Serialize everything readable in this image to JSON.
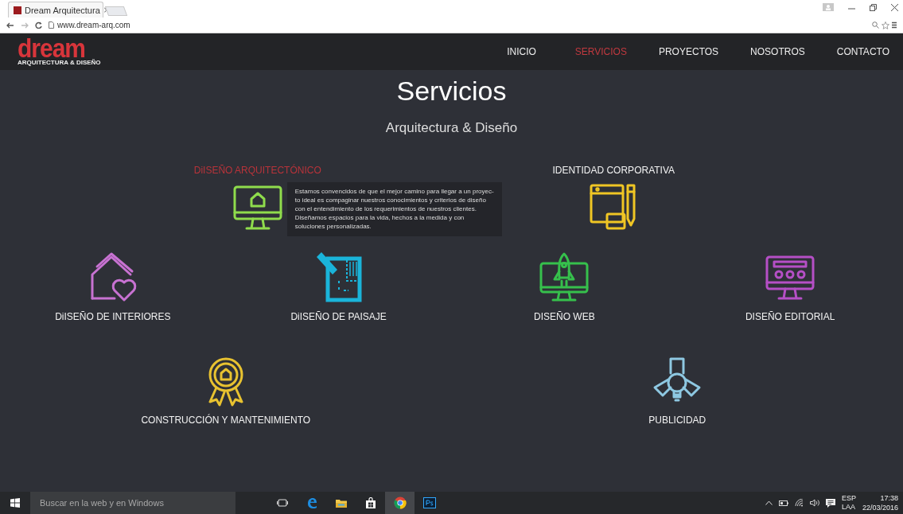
{
  "browser": {
    "tab": {
      "title": "Dream Arquitectura",
      "close": "×"
    },
    "url": "www.dream-arq.com"
  },
  "site": {
    "logo": {
      "word": "dream",
      "tagline": "ARQUITECTURA & DISEÑO"
    },
    "nav": [
      {
        "label": "INICIO",
        "selected": false
      },
      {
        "label": "SERVICIOS",
        "selected": true
      },
      {
        "label": "PROYECTOS",
        "selected": false
      },
      {
        "label": "NOSOTROS",
        "selected": false
      },
      {
        "label": "CONTACTO",
        "selected": false
      }
    ],
    "title": "Servicios",
    "subtitle": "Arquitectura & Diseño",
    "service_rows": [
      {
        "kind": "label_top",
        "services": [
          {
            "label": "DiISEÑO ARQUITECTÓNICO",
            "color": "#8fdc4c",
            "highlighted": true,
            "tooltip": "Estamos convencidos de que el mejor camino para llegar a un proyec-to ideal es compaginar nuestros conocimientos y criterios de diseño con el entendimiento de los requerimientos de nuestros clientes. Diseñamos espacios para la vida, hechos a la medida y con soluciones personalizadas."
          },
          {
            "label": "IDENTIDAD CORPORATIVA",
            "color": "#f0c624",
            "highlighted": false
          }
        ]
      },
      {
        "kind": "label_bottom",
        "services": [
          {
            "label": "DiISEÑO DE INTERIORES",
            "color": "#c872d2",
            "highlighted": false
          },
          {
            "label": "DiISEÑO DE PAISAJE",
            "color": "#1ab4da",
            "highlighted": false
          },
          {
            "label": "DISEÑO WEB",
            "color": "#36c04c",
            "highlighted": false
          },
          {
            "label": "DISEÑO EDITORIAL",
            "color": "#b54fc6",
            "highlighted": false
          }
        ]
      },
      {
        "kind": "label_bottom",
        "services": [
          {
            "label": "CONSTRUCCIÓN Y MANTENIMIENTO",
            "color": "#e8c230",
            "highlighted": false
          },
          {
            "label": "PUBLICIDAD",
            "color": "#8ec8e2",
            "highlighted": false
          }
        ]
      }
    ]
  },
  "taskbar": {
    "search_placeholder": "Buscar en la web y en Windows",
    "language": "ESP",
    "layout": "LAA",
    "time": "17:38",
    "date": "22/03/2016"
  }
}
